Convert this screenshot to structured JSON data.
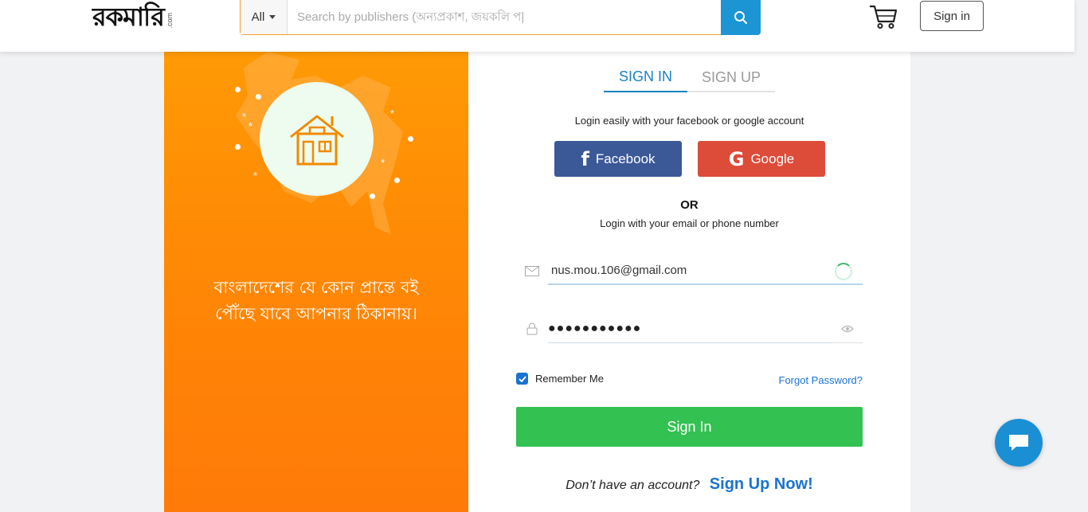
{
  "header": {
    "logo_text": "রকমারি",
    "logo_suffix": ".com",
    "search_category": "All",
    "search_placeholder": "Search by publishers (অন্যপ্রকাশ, জয়কলি প|",
    "signin_label": "Sign in"
  },
  "promo": {
    "tagline_line1": "বাংলাদেশের যে কোন প্রান্তে বই",
    "tagline_line2": "পৌঁছে যাবে আপনার ঠিকানায়।"
  },
  "auth": {
    "tabs": [
      {
        "label": "SIGN IN",
        "active": true
      },
      {
        "label": "SIGN UP",
        "active": false
      }
    ],
    "social_note": "Login easily with your facebook or google account",
    "facebook_label": "Facebook",
    "google_label": "Google",
    "or_label": "OR",
    "email_note": "Login with your email or phone number",
    "email_value": "nus.mou.106@gmail.com",
    "password_value": "●●●●●●●●●●●",
    "remember_label": "Remember Me",
    "remember_checked": true,
    "forgot_label": "Forgot Password?",
    "submit_label": "Sign In",
    "no_account_label": "Don’t have an account?",
    "signup_link": "Sign Up Now!"
  },
  "colors": {
    "brand_orange": "#ff8a05",
    "accent_blue": "#1a82c4",
    "facebook": "#3b5897",
    "google": "#dd4b39",
    "submit_green": "#33c152",
    "chat_blue": "#1a8fd4"
  }
}
